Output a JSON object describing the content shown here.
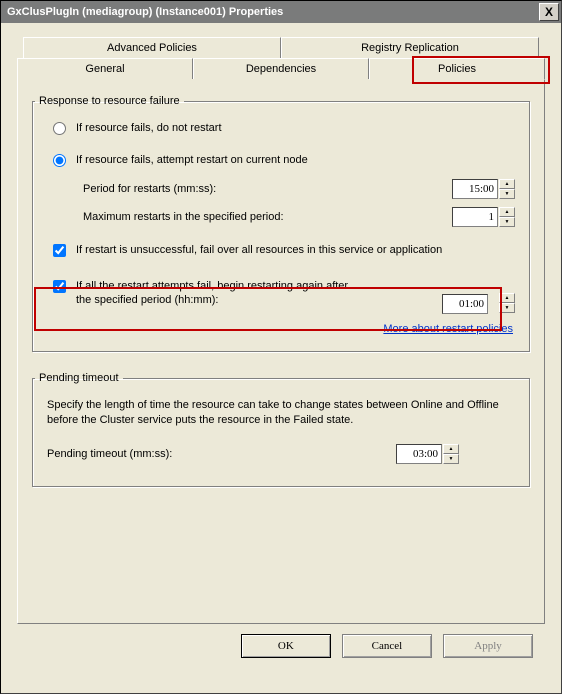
{
  "window": {
    "title": "GxClusPlugIn (mediagroup) (Instance001) Properties",
    "close_label": "X"
  },
  "tabs": {
    "row1": [
      "Advanced Policies",
      "Registry Replication"
    ],
    "row2": [
      "General",
      "Dependencies",
      "Policies"
    ],
    "active": "Policies"
  },
  "group_failure": {
    "legend": "Response to resource failure",
    "radio_no_restart": "If resource fails, do not restart",
    "radio_attempt": "If resource fails, attempt restart on current node",
    "period_label": "Period for restarts (mm:ss):",
    "period_value": "15:00",
    "max_label": "Maximum restarts in the specified period:",
    "max_value": "1",
    "chk_failover": "If restart is unsuccessful, fail over all resources in this service or application",
    "chk_retry_label": "If all the restart attempts fail, begin restarting again after the specified period (hh:mm):",
    "retry_value": "01:00",
    "link": "More about restart policies"
  },
  "group_pending": {
    "legend": "Pending timeout",
    "desc": "Specify the length of time the resource can take to change states between Online and Offline before the Cluster service puts the resource in the Failed state.",
    "label": "Pending timeout (mm:ss):",
    "value": "03:00"
  },
  "buttons": {
    "ok": "OK",
    "cancel": "Cancel",
    "apply": "Apply"
  }
}
